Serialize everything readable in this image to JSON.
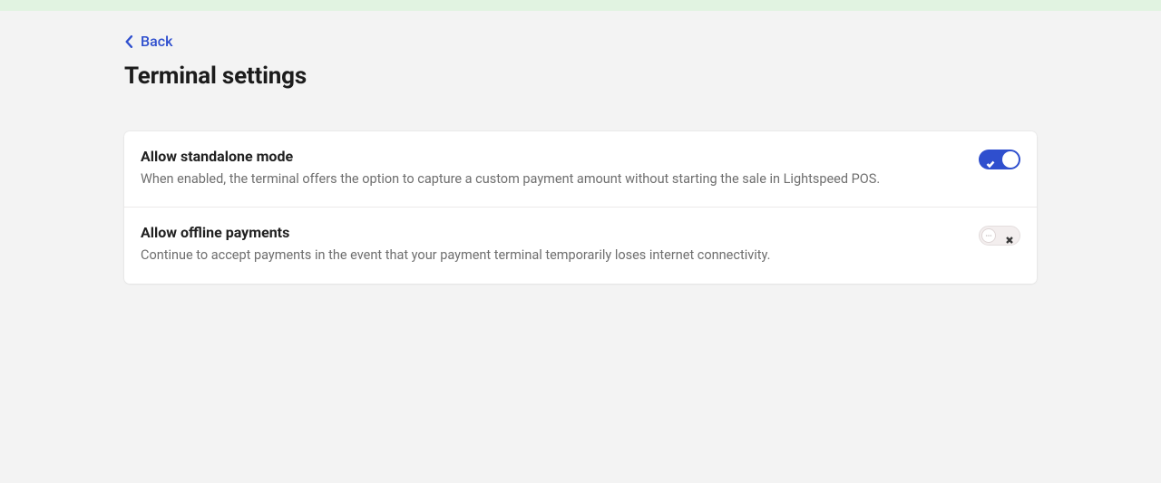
{
  "nav": {
    "back_label": "Back"
  },
  "page": {
    "title": "Terminal settings"
  },
  "settings": [
    {
      "title": "Allow standalone mode",
      "description": "When enabled, the terminal offers the option to capture a custom payment amount without starting the sale in Lightspeed POS.",
      "enabled": true
    },
    {
      "title": "Allow offline payments",
      "description": "Continue to accept payments in the event that your payment terminal temporarily loses internet connectivity.",
      "enabled": false
    }
  ]
}
